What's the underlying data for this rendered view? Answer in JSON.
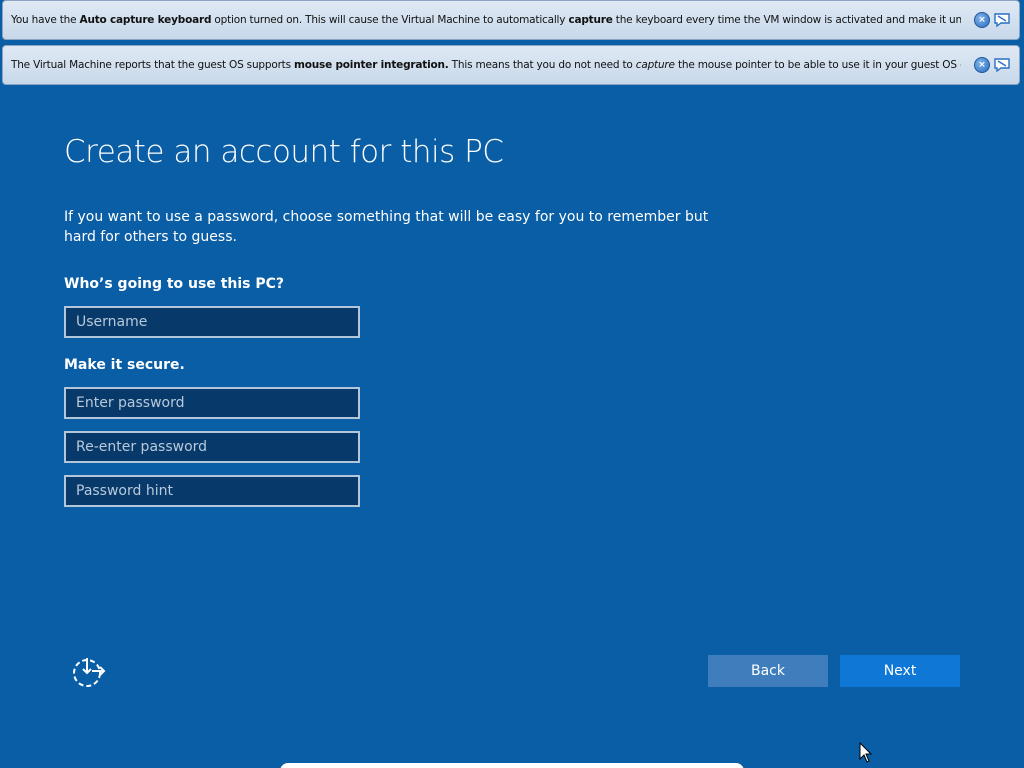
{
  "notifications": [
    {
      "segments": [
        {
          "text": "You have the ",
          "style": "normal"
        },
        {
          "text": "Auto capture keyboard",
          "style": "bold"
        },
        {
          "text": " option turned on. This will cause the Virtual Machine to automatically ",
          "style": "normal"
        },
        {
          "text": "capture",
          "style": "bold"
        },
        {
          "text": " the keyboard every time the VM window is activated and make it unavailable to",
          "style": "normal"
        }
      ]
    },
    {
      "segments": [
        {
          "text": "The Virtual Machine reports that the guest OS supports ",
          "style": "normal"
        },
        {
          "text": "mouse pointer integration.",
          "style": "bold"
        },
        {
          "text": " This means that you do not need to ",
          "style": "normal"
        },
        {
          "text": "capture",
          "style": "italic"
        },
        {
          "text": " the mouse pointer to be able to use it in your guest OS -- all mouse",
          "style": "normal"
        }
      ]
    }
  ],
  "page": {
    "title": "Create an account for this PC",
    "description": "If you want to use a password, choose something that will be easy for you to remember but hard for others to guess.",
    "who_label": "Who’s going to use this PC?",
    "secure_label": "Make it secure."
  },
  "fields": {
    "username": {
      "placeholder": "Username",
      "value": ""
    },
    "password": {
      "placeholder": "Enter password",
      "value": ""
    },
    "reenter": {
      "placeholder": "Re-enter password",
      "value": ""
    },
    "hint": {
      "placeholder": "Password hint",
      "value": ""
    }
  },
  "buttons": {
    "back": "Back",
    "next": "Next"
  },
  "icons": {
    "ease_of_access": "ease-of-access-icon",
    "notification_close": "close-icon",
    "notification_dismiss": "dismiss-message-icon",
    "cursor": "mouse-pointer-icon"
  },
  "colors": {
    "background": "#0a5ea6",
    "field_background": "#073a6b",
    "back_button": "#3f7dbd",
    "next_button": "#0f78d7"
  }
}
